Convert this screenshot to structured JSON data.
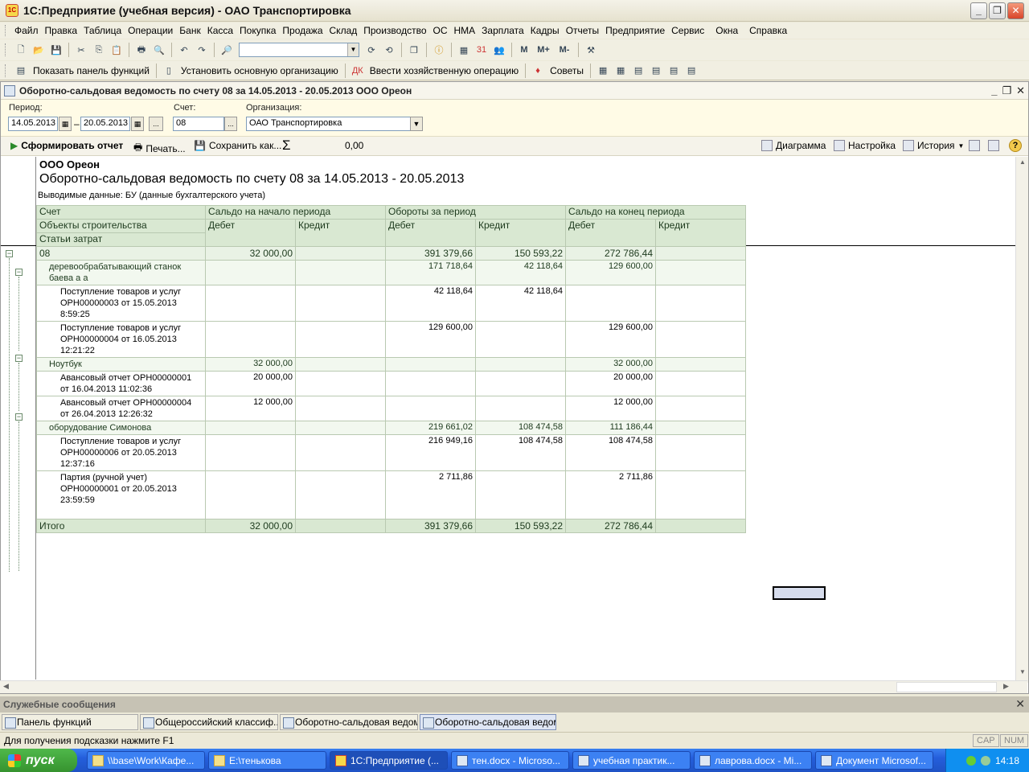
{
  "window": {
    "title": "1С:Предприятие (учебная версия) - ОАО Транспортировка"
  },
  "menu": [
    "Файл",
    "Правка",
    "Таблица",
    "Операции",
    "Банк",
    "Касса",
    "Покупка",
    "Продажа",
    "Склад",
    "Производство",
    "ОС",
    "НМА",
    "Зарплата",
    "Кадры",
    "Отчеты",
    "Предприятие",
    "Сервис",
    "Окна",
    "Справка"
  ],
  "toolbar2": {
    "show_panel": "Показать панель функций",
    "set_org": "Установить основную организацию",
    "enter_op": "Ввести хозяйственную операцию",
    "tips": "Советы"
  },
  "doc": {
    "title": "Оборотно-сальдовая ведомость по счету 08 за 14.05.2013 - 20.05.2013 ООО Ореон",
    "params": {
      "period_label": "Период:",
      "date_from": "14.05.2013",
      "date_to": "20.05.2013",
      "account_label": "Счет:",
      "account": "08",
      "org_label": "Организация:",
      "org": "ОАО Транспортировка"
    },
    "commands": {
      "generate": "Сформировать отчет",
      "print": "Печать...",
      "save_as": "Сохранить как...",
      "sum": "0,00",
      "chart": "Диаграмма",
      "settings": "Настройка",
      "history": "История"
    }
  },
  "report": {
    "org": "ООО Ореон",
    "title": "Оборотно-сальдовая ведомость по счету 08 за 14.05.2013 - 20.05.2013",
    "subtitle": "Выводимые данные:  БУ (данные бухгалтерского учета)",
    "header": {
      "account": "Счет",
      "objects": "Объекты строительства",
      "costs": "Статьи затрат",
      "opening": "Сальдо на начало периода",
      "turnover": "Обороты за период",
      "closing": "Сальдо на конец периода",
      "debit": "Дебет",
      "credit": "Кредит"
    },
    "rows": [
      {
        "level": 1,
        "name": "08",
        "v": [
          "32 000,00",
          "",
          "391 379,66",
          "150 593,22",
          "272 786,44",
          ""
        ]
      },
      {
        "level": 2,
        "name": "деревообрабатывающий станок баева а а",
        "v": [
          "",
          "",
          "171 718,64",
          "42 118,64",
          "129 600,00",
          ""
        ]
      },
      {
        "level": 3,
        "name": "Поступление товаров и услуг ОРН00000003 от 15.05.2013 8:59:25",
        "v": [
          "",
          "",
          "42 118,64",
          "42 118,64",
          "",
          ""
        ]
      },
      {
        "level": 3,
        "name": "Поступление товаров и услуг ОРН00000004 от 16.05.2013 12:21:22",
        "v": [
          "",
          "",
          "129 600,00",
          "",
          "129 600,00",
          ""
        ]
      },
      {
        "level": 2,
        "name": "Ноутбук",
        "v": [
          "32 000,00",
          "",
          "",
          "",
          "32 000,00",
          ""
        ]
      },
      {
        "level": 3,
        "name": "Авансовый отчет ОРН00000001 от 16.04.2013 11:02:36",
        "v": [
          "20 000,00",
          "",
          "",
          "",
          "20 000,00",
          ""
        ]
      },
      {
        "level": 3,
        "name": "Авансовый отчет ОРН00000004 от 26.04.2013 12:26:32",
        "v": [
          "12 000,00",
          "",
          "",
          "",
          "12 000,00",
          ""
        ]
      },
      {
        "level": 2,
        "name": "оборудование Симонова",
        "v": [
          "",
          "",
          "219 661,02",
          "108 474,58",
          "111 186,44",
          ""
        ]
      },
      {
        "level": 3,
        "name": "Поступление товаров и услуг ОРН00000006 от 20.05.2013 12:37:16",
        "v": [
          "",
          "",
          "216 949,16",
          "108 474,58",
          "108 474,58",
          ""
        ]
      },
      {
        "level": 3,
        "name": "Партия (ручной учет) ОРН00000001 от 20.05.2013 23:59:59",
        "v": [
          "",
          "",
          "2 711,86",
          "",
          "2 711,86",
          ""
        ]
      }
    ],
    "total": {
      "name": "Итого",
      "v": [
        "32 000,00",
        "",
        "391 379,66",
        "150 593,22",
        "272 786,44",
        ""
      ]
    }
  },
  "service_messages": "Служебные сообщения",
  "window_tabs": [
    "Панель функций",
    "Общероссийский классиф...",
    "Оборотно-сальдовая ведом...",
    "Оборотно-сальдовая ведом..."
  ],
  "status": {
    "hint": "Для получения подсказки нажмите F1",
    "cap": "CAP",
    "num": "NUM"
  },
  "taskbar": {
    "start": "пуск",
    "items": [
      "\\\\base\\Work\\Кафе...",
      "E:\\тенькова",
      "1С:Предприятие (...",
      "тен.docx - Microso...",
      "учебная практик...",
      "лаврова.docx - Mi...",
      "Документ Microsof..."
    ],
    "clock": "14:18"
  }
}
